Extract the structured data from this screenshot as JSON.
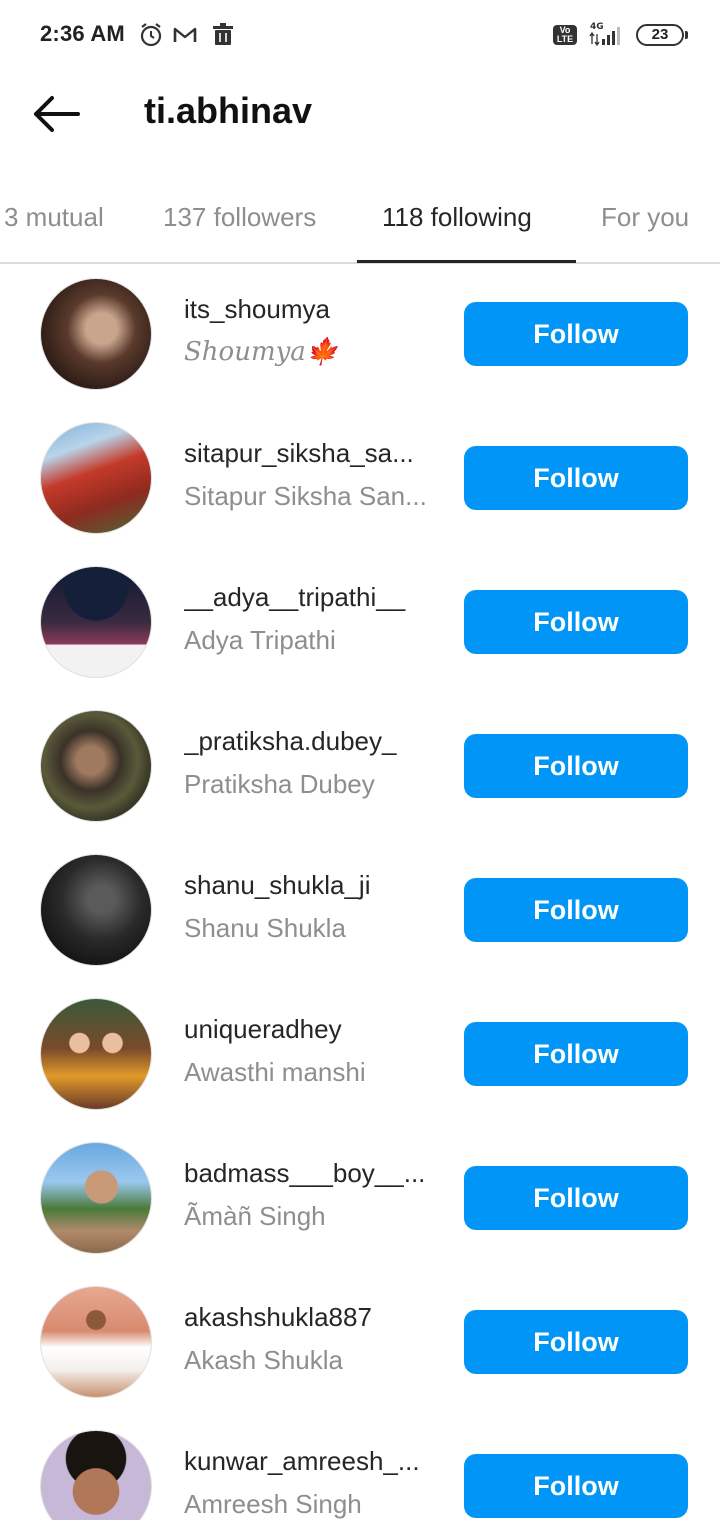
{
  "status_bar": {
    "time": "2:36 AM",
    "icons": [
      "alarm-icon",
      "gmail-icon",
      "trash-icon"
    ],
    "volte": "Vo LTE",
    "network": "4G",
    "battery": "23"
  },
  "header": {
    "title": "ti.abhinav",
    "back_icon": "arrow-left-icon"
  },
  "tabs": [
    {
      "label": "3 mutual",
      "active": false
    },
    {
      "label": "137 followers",
      "active": false
    },
    {
      "label": "118 following",
      "active": true
    },
    {
      "label": "For you",
      "active": false
    }
  ],
  "users": [
    {
      "username": "its_shoumya",
      "full_name": "Shoumya🍁",
      "button": "Follow"
    },
    {
      "username": "sitapur_siksha_sa...",
      "full_name": "Sitapur Siksha San...",
      "button": "Follow"
    },
    {
      "username": "__adya__tripathi__",
      "full_name": "Adya Tripathi",
      "button": "Follow"
    },
    {
      "username": "_pratiksha.dubey_",
      "full_name": "Pratiksha Dubey",
      "button": "Follow"
    },
    {
      "username": "shanu_shukla_ji",
      "full_name": "Shanu Shukla",
      "button": "Follow"
    },
    {
      "username": "uniqueradhey",
      "full_name": "Awasthi manshi",
      "button": "Follow"
    },
    {
      "username": "badmass___boy__...",
      "full_name": "Ãmàñ Singh",
      "button": "Follow"
    },
    {
      "username": "akashshukla887",
      "full_name": "Akash Shukla",
      "button": "Follow"
    },
    {
      "username": "kunwar_amreesh_...",
      "full_name": "Amreesh Singh",
      "button": "Follow"
    }
  ],
  "colors": {
    "accent": "#0095f6",
    "text_primary": "#262626",
    "text_secondary": "#8e8e8e"
  }
}
